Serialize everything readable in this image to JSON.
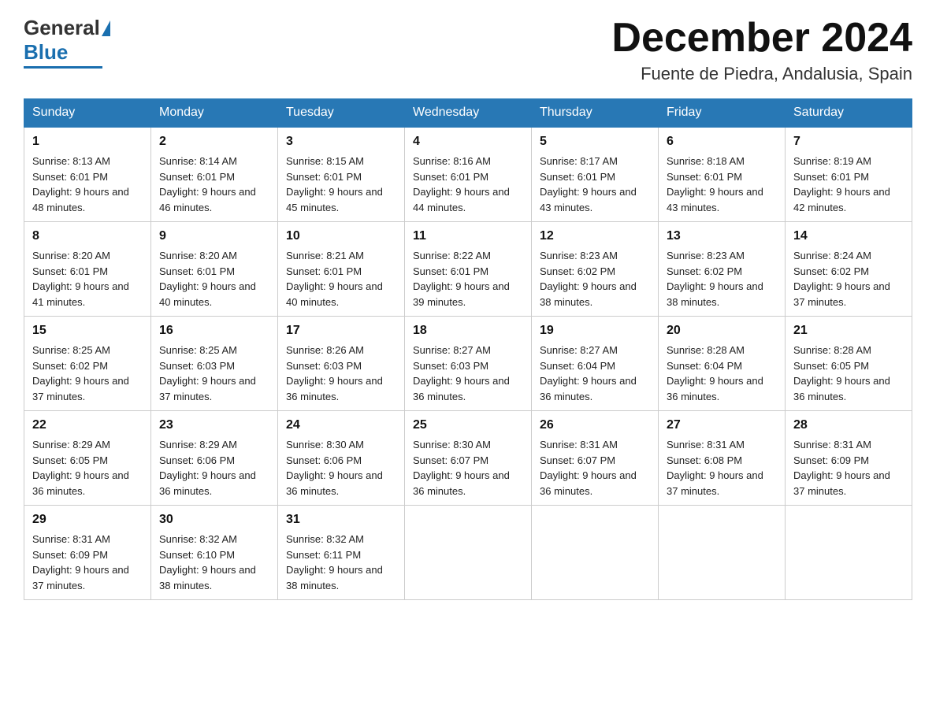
{
  "header": {
    "month_title": "December 2024",
    "location": "Fuente de Piedra, Andalusia, Spain",
    "logo_general": "General",
    "logo_blue": "Blue"
  },
  "weekdays": [
    "Sunday",
    "Monday",
    "Tuesday",
    "Wednesday",
    "Thursday",
    "Friday",
    "Saturday"
  ],
  "weeks": [
    [
      {
        "day": "1",
        "sunrise": "8:13 AM",
        "sunset": "6:01 PM",
        "daylight": "9 hours and 48 minutes."
      },
      {
        "day": "2",
        "sunrise": "8:14 AM",
        "sunset": "6:01 PM",
        "daylight": "9 hours and 46 minutes."
      },
      {
        "day": "3",
        "sunrise": "8:15 AM",
        "sunset": "6:01 PM",
        "daylight": "9 hours and 45 minutes."
      },
      {
        "day": "4",
        "sunrise": "8:16 AM",
        "sunset": "6:01 PM",
        "daylight": "9 hours and 44 minutes."
      },
      {
        "day": "5",
        "sunrise": "8:17 AM",
        "sunset": "6:01 PM",
        "daylight": "9 hours and 43 minutes."
      },
      {
        "day": "6",
        "sunrise": "8:18 AM",
        "sunset": "6:01 PM",
        "daylight": "9 hours and 43 minutes."
      },
      {
        "day": "7",
        "sunrise": "8:19 AM",
        "sunset": "6:01 PM",
        "daylight": "9 hours and 42 minutes."
      }
    ],
    [
      {
        "day": "8",
        "sunrise": "8:20 AM",
        "sunset": "6:01 PM",
        "daylight": "9 hours and 41 minutes."
      },
      {
        "day": "9",
        "sunrise": "8:20 AM",
        "sunset": "6:01 PM",
        "daylight": "9 hours and 40 minutes."
      },
      {
        "day": "10",
        "sunrise": "8:21 AM",
        "sunset": "6:01 PM",
        "daylight": "9 hours and 40 minutes."
      },
      {
        "day": "11",
        "sunrise": "8:22 AM",
        "sunset": "6:01 PM",
        "daylight": "9 hours and 39 minutes."
      },
      {
        "day": "12",
        "sunrise": "8:23 AM",
        "sunset": "6:02 PM",
        "daylight": "9 hours and 38 minutes."
      },
      {
        "day": "13",
        "sunrise": "8:23 AM",
        "sunset": "6:02 PM",
        "daylight": "9 hours and 38 minutes."
      },
      {
        "day": "14",
        "sunrise": "8:24 AM",
        "sunset": "6:02 PM",
        "daylight": "9 hours and 37 minutes."
      }
    ],
    [
      {
        "day": "15",
        "sunrise": "8:25 AM",
        "sunset": "6:02 PM",
        "daylight": "9 hours and 37 minutes."
      },
      {
        "day": "16",
        "sunrise": "8:25 AM",
        "sunset": "6:03 PM",
        "daylight": "9 hours and 37 minutes."
      },
      {
        "day": "17",
        "sunrise": "8:26 AM",
        "sunset": "6:03 PM",
        "daylight": "9 hours and 36 minutes."
      },
      {
        "day": "18",
        "sunrise": "8:27 AM",
        "sunset": "6:03 PM",
        "daylight": "9 hours and 36 minutes."
      },
      {
        "day": "19",
        "sunrise": "8:27 AM",
        "sunset": "6:04 PM",
        "daylight": "9 hours and 36 minutes."
      },
      {
        "day": "20",
        "sunrise": "8:28 AM",
        "sunset": "6:04 PM",
        "daylight": "9 hours and 36 minutes."
      },
      {
        "day": "21",
        "sunrise": "8:28 AM",
        "sunset": "6:05 PM",
        "daylight": "9 hours and 36 minutes."
      }
    ],
    [
      {
        "day": "22",
        "sunrise": "8:29 AM",
        "sunset": "6:05 PM",
        "daylight": "9 hours and 36 minutes."
      },
      {
        "day": "23",
        "sunrise": "8:29 AM",
        "sunset": "6:06 PM",
        "daylight": "9 hours and 36 minutes."
      },
      {
        "day": "24",
        "sunrise": "8:30 AM",
        "sunset": "6:06 PM",
        "daylight": "9 hours and 36 minutes."
      },
      {
        "day": "25",
        "sunrise": "8:30 AM",
        "sunset": "6:07 PM",
        "daylight": "9 hours and 36 minutes."
      },
      {
        "day": "26",
        "sunrise": "8:31 AM",
        "sunset": "6:07 PM",
        "daylight": "9 hours and 36 minutes."
      },
      {
        "day": "27",
        "sunrise": "8:31 AM",
        "sunset": "6:08 PM",
        "daylight": "9 hours and 37 minutes."
      },
      {
        "day": "28",
        "sunrise": "8:31 AM",
        "sunset": "6:09 PM",
        "daylight": "9 hours and 37 minutes."
      }
    ],
    [
      {
        "day": "29",
        "sunrise": "8:31 AM",
        "sunset": "6:09 PM",
        "daylight": "9 hours and 37 minutes."
      },
      {
        "day": "30",
        "sunrise": "8:32 AM",
        "sunset": "6:10 PM",
        "daylight": "9 hours and 38 minutes."
      },
      {
        "day": "31",
        "sunrise": "8:32 AM",
        "sunset": "6:11 PM",
        "daylight": "9 hours and 38 minutes."
      },
      null,
      null,
      null,
      null
    ]
  ]
}
